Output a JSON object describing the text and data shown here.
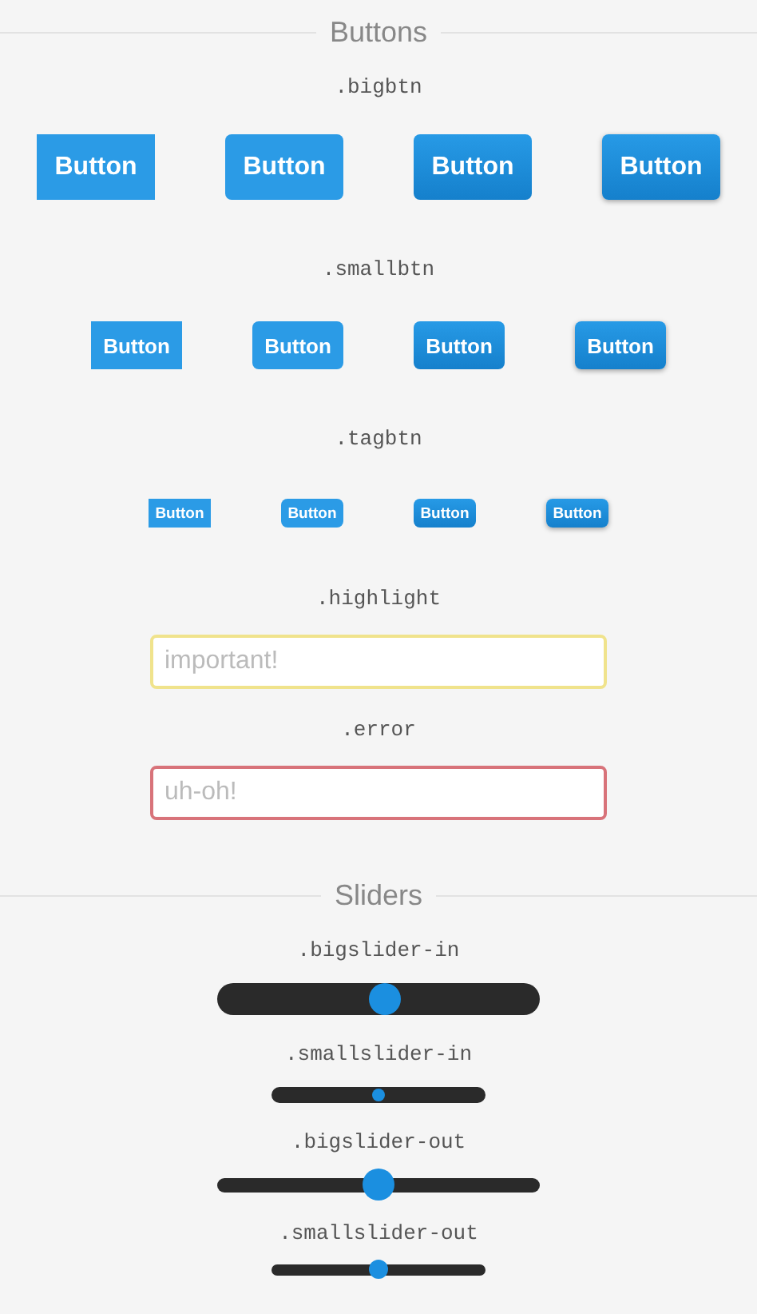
{
  "sections": [
    {
      "title": "Buttons",
      "groups": [
        {
          "kind": "bigbtn",
          "label": ".bigbtn",
          "buttons": [
            {
              "label": "Button",
              "kind": "flat"
            },
            {
              "label": "Button",
              "kind": "rounded"
            },
            {
              "label": "Button",
              "kind": "gradient"
            },
            {
              "label": "Button",
              "kind": "raised"
            }
          ]
        },
        {
          "kind": "smallbtn",
          "label": ".smallbtn",
          "buttons": [
            {
              "label": "Button",
              "kind": "flat"
            },
            {
              "label": "Button",
              "kind": "rounded"
            },
            {
              "label": "Button",
              "kind": "gradient"
            },
            {
              "label": "Button",
              "kind": "raised"
            }
          ]
        },
        {
          "kind": "tagbtn",
          "label": ".tagbtn",
          "buttons": [
            {
              "label": "Button",
              "kind": "flat"
            },
            {
              "label": "Button",
              "kind": "rounded"
            },
            {
              "label": "Button",
              "kind": "gradient"
            },
            {
              "label": "Button",
              "kind": "raised"
            }
          ]
        },
        {
          "kind": "highlight",
          "label": ".highlight",
          "placeholder": "important!"
        },
        {
          "kind": "error",
          "label": ".error",
          "placeholder": "uh-oh!"
        }
      ]
    },
    {
      "title": "Sliders",
      "groups": [
        {
          "kind": "biginslider",
          "label": ".bigslider-in",
          "level": 0.52
        },
        {
          "kind": "smallinslider",
          "label": ".smallslider-in",
          "level": 0.5
        },
        {
          "kind": "bigoutslider",
          "label": ".bigslider-out",
          "level": 0.5
        },
        {
          "kind": "smalloutslider",
          "label": ".smallslider-out",
          "level": 0.5
        }
      ]
    }
  ]
}
